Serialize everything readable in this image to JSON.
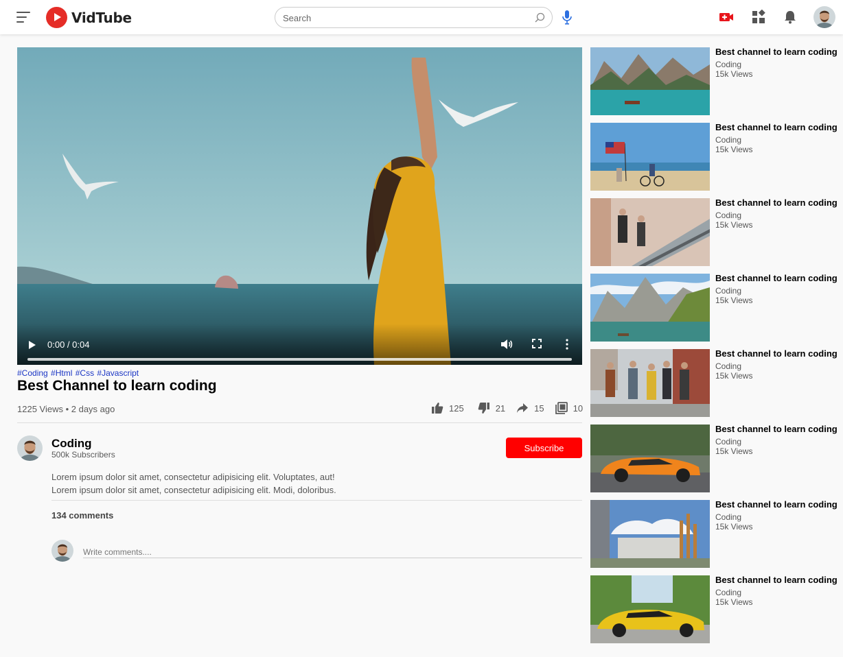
{
  "brand": {
    "name": "VidTube",
    "accent": "#e52d27"
  },
  "header": {
    "menu_icon": "hamburger-menu-icon",
    "search_placeholder": "Search",
    "icons": [
      "search-icon",
      "mic-icon",
      "upload-video-icon",
      "apps-icon",
      "notification-bell-icon",
      "user-avatar"
    ]
  },
  "player": {
    "time": "0:00 / 0:04",
    "progress": 0
  },
  "video": {
    "tags": [
      "#Coding",
      "#Html",
      "#Css",
      "#Javascript"
    ],
    "title": "Best Channel to learn coding",
    "meta": "1225 Views • 2 days ago",
    "likes": "125",
    "dislikes": "21",
    "shares": "15",
    "saves": "10"
  },
  "channel": {
    "name": "Coding",
    "subscribers": "500k Subscribers",
    "subscribe_label": "Subscribe",
    "description": [
      "Lorem ipsum dolor sit amet, consectetur adipisicing elit. Voluptates, aut!",
      "Lorem ipsum dolor sit amet, consectetur adipisicing elit. Modi, doloribus."
    ]
  },
  "comments": {
    "count_label": "134 comments",
    "placeholder": "Write comments...."
  },
  "sidebar": {
    "items": [
      {
        "title": "Best channel to learn coding",
        "channel": "Coding",
        "views": "15k Views",
        "thumb": "lake-mountains"
      },
      {
        "title": "Best channel to learn coding",
        "channel": "Coding",
        "views": "15k Views",
        "thumb": "beach-flag-bike"
      },
      {
        "title": "Best channel to learn coding",
        "channel": "Coding",
        "views": "15k Views",
        "thumb": "escalator"
      },
      {
        "title": "Best channel to learn coding",
        "channel": "Coding",
        "views": "15k Views",
        "thumb": "alpine-lake"
      },
      {
        "title": "Best channel to learn coding",
        "channel": "Coding",
        "views": "15k Views",
        "thumb": "friends-walking"
      },
      {
        "title": "Best channel to learn coding",
        "channel": "Coding",
        "views": "15k Views",
        "thumb": "orange-sports-car"
      },
      {
        "title": "Best channel to learn coding",
        "channel": "Coding",
        "views": "15k Views",
        "thumb": "campus-building"
      },
      {
        "title": "Best channel to learn coding",
        "channel": "Coding",
        "views": "15k Views",
        "thumb": "yellow-sports-car"
      }
    ]
  }
}
